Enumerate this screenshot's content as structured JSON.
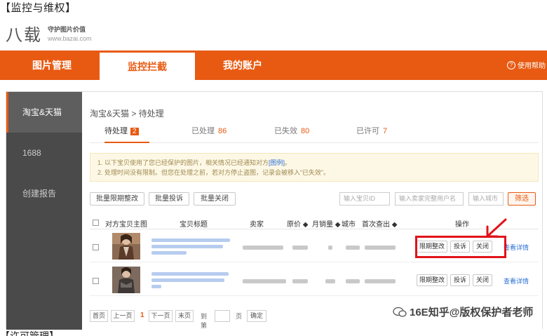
{
  "caption_top": "【监控与维权】",
  "caption_bottom": "【许可管理】",
  "logo": {
    "mark": "八载",
    "slogan": "守护图片价值",
    "url": "www.bazai.com"
  },
  "topnav": {
    "tabs": [
      "图片管理",
      "监控拦截",
      "我的账户"
    ],
    "active_index": 1,
    "help": "使用帮助"
  },
  "sidebar": {
    "items": [
      "淘宝&天猫",
      "1688",
      "创建报告"
    ],
    "active_index": 0
  },
  "breadcrumb": "淘宝&天猫 > 待处理",
  "subtabs": [
    {
      "label": "待处理",
      "count": "2"
    },
    {
      "label": "已处理",
      "count": "86"
    },
    {
      "label": "已失效",
      "count": "80"
    },
    {
      "label": "已许可",
      "count": "7"
    }
  ],
  "notice": {
    "line1": "1. 以下宝贝使用了您已经保护的图片，相关情况已经通知对方",
    "line1_link": "[图例]",
    "line1_end": "。",
    "line2": "2. 处理时间没有限制。但您在处理之前，若对方停止盗图，记录会被移入“已失效”。"
  },
  "toolbar": {
    "batch_rectify": "批量限期整改",
    "batch_complain": "批量投诉",
    "batch_close": "批量关闭",
    "id_placeholder": "输入宝贝ID",
    "seller_placeholder": "输入卖家完整用户名",
    "city_placeholder": "输入城市",
    "filter": "筛选"
  },
  "table": {
    "headers": [
      "对方宝贝主图",
      "宝贝标题",
      "卖家",
      "原价 ◆",
      "月销量 ◆",
      "城市",
      "首次查出 ◆",
      "操作"
    ],
    "actions": [
      "限期整改",
      "投诉",
      "关闭",
      "查看详情"
    ]
  },
  "pager": {
    "first": "首页",
    "prev": "上一页",
    "current": "1",
    "next": "下一页",
    "last": "末页",
    "goto": "到第",
    "page": "页",
    "confirm": "确定"
  },
  "watermark": "16E知乎@版权保护者老师",
  "colors": {
    "accent": "#e85a12",
    "highlight": "#e1131a",
    "sidebar": "#4a4a4a",
    "link": "#2a6fd6"
  }
}
